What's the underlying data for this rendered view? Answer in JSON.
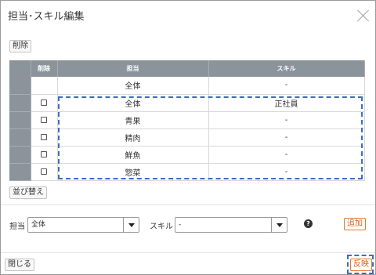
{
  "dialog": {
    "title": "担当･スキル編集",
    "delete_button": "削除",
    "table": {
      "headers": {
        "delete": "削除",
        "tanto": "担当",
        "skill": "スキル"
      },
      "rows": [
        {
          "tanto": "全体",
          "skill": "-",
          "checkbox": false
        },
        {
          "tanto": "全体",
          "skill": "正社員",
          "checkbox": true
        },
        {
          "tanto": "青果",
          "skill": "-",
          "checkbox": true
        },
        {
          "tanto": "精肉",
          "skill": "-",
          "checkbox": true
        },
        {
          "tanto": "鮮魚",
          "skill": "-",
          "checkbox": true
        },
        {
          "tanto": "惣菜",
          "skill": "-",
          "checkbox": true
        }
      ]
    },
    "reorder_button": "並び替え",
    "form": {
      "tanto_label": "担当",
      "tanto_value": "全体",
      "skill_label": "スキル",
      "skill_value": "-",
      "help_icon": "?",
      "add_button": "追加"
    },
    "footer": {
      "close_button": "閉じる",
      "apply_button": "反映"
    },
    "colors": {
      "header_bg": "#8b939b",
      "highlight": "#3f6cc0",
      "accent_orange": "#e0601a"
    }
  }
}
